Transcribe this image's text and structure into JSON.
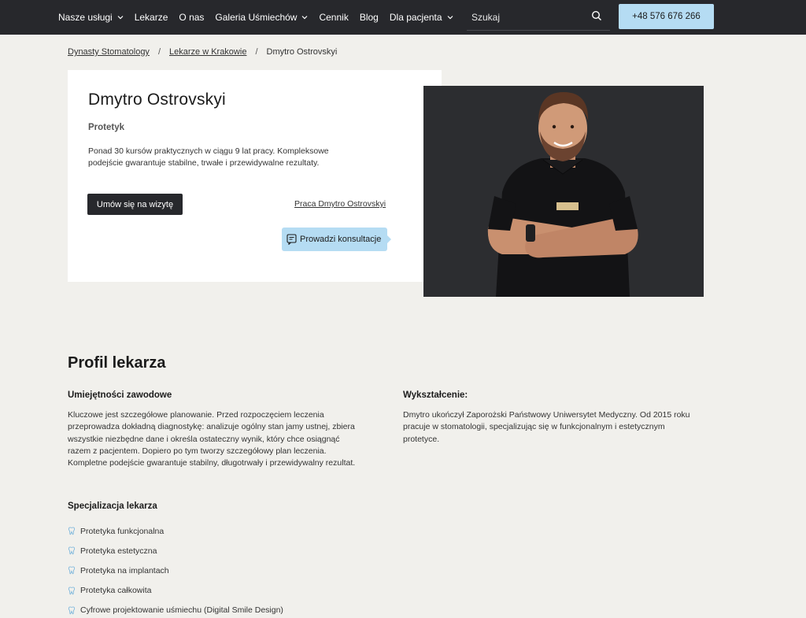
{
  "nav": {
    "items": [
      {
        "label": "Nasze usługi",
        "dropdown": true
      },
      {
        "label": "Lekarze",
        "dropdown": false
      },
      {
        "label": "O nas",
        "dropdown": false
      },
      {
        "label": "Galeria Uśmiechów",
        "dropdown": true
      },
      {
        "label": "Cennik",
        "dropdown": false
      },
      {
        "label": "Blog",
        "dropdown": false
      },
      {
        "label": "Dla pacjenta",
        "dropdown": true
      }
    ],
    "search_placeholder": "Szukaj",
    "phone": "+48 576 676 266"
  },
  "breadcrumb": {
    "items": [
      "Dynasty Stomatology",
      "Lekarze w Krakowie",
      "Dmytro Ostrovskyi"
    ],
    "separator": "/"
  },
  "doctor": {
    "name": "Dmytro Ostrovskyi",
    "role": "Protetyk",
    "description": "Ponad 30 kursów praktycznych w ciągu 9 lat pracy. Kompleksowe podejście gwarantuje stabilne, trwałe i przewidywalne rezultaty.",
    "book_label": "Umów się na wizytę",
    "works_link": "Praca Dmytro Ostrovskyi",
    "consult_badge": "Prowadzi konsultacje"
  },
  "profile": {
    "title": "Profil lekarza",
    "skills_heading": "Umiejętności zawodowe",
    "skills_text": "Kluczowe jest szczegółowe planowanie. Przed rozpoczęciem leczenia przeprowadza dokładną diagnostykę: analizuje ogólny stan jamy ustnej, zbiera wszystkie niezbędne dane i określa ostateczny wynik, który chce osiągnąć razem z pacjentem. Dopiero po tym tworzy szczegółowy plan leczenia. Kompletne podejście gwarantuje stabilny, długotrwały i przewidywalny rezultat.",
    "education_heading": "Wykształcenie:",
    "education_text": "Dmytro ukończył Zaporożski Państwowy Uniwersytet Medyczny. Od 2015 roku pracuje w stomatologii, specjalizując się w funkcjonalnym i estetycznym protetyce.",
    "spec_heading": "Specjalizacja lekarza",
    "specializations": [
      "Protetyka funkcjonalna",
      "Protetyka estetyczna",
      "Protetyka na implantach",
      "Protetyka całkowita",
      "Cyfrowe projektowanie uśmiechu (Digital Smile Design)"
    ]
  },
  "colors": {
    "nav_bg": "#27282c",
    "accent": "#b5dcf3",
    "page_bg": "#f1f0ec",
    "card_bg": "#ffffff",
    "tooth_icon": "#7fb8dc"
  },
  "icons": {
    "dropdown": "chevron-down-icon",
    "search": "search-icon",
    "consult": "chat-note-icon",
    "specialization": "tooth-icon"
  }
}
